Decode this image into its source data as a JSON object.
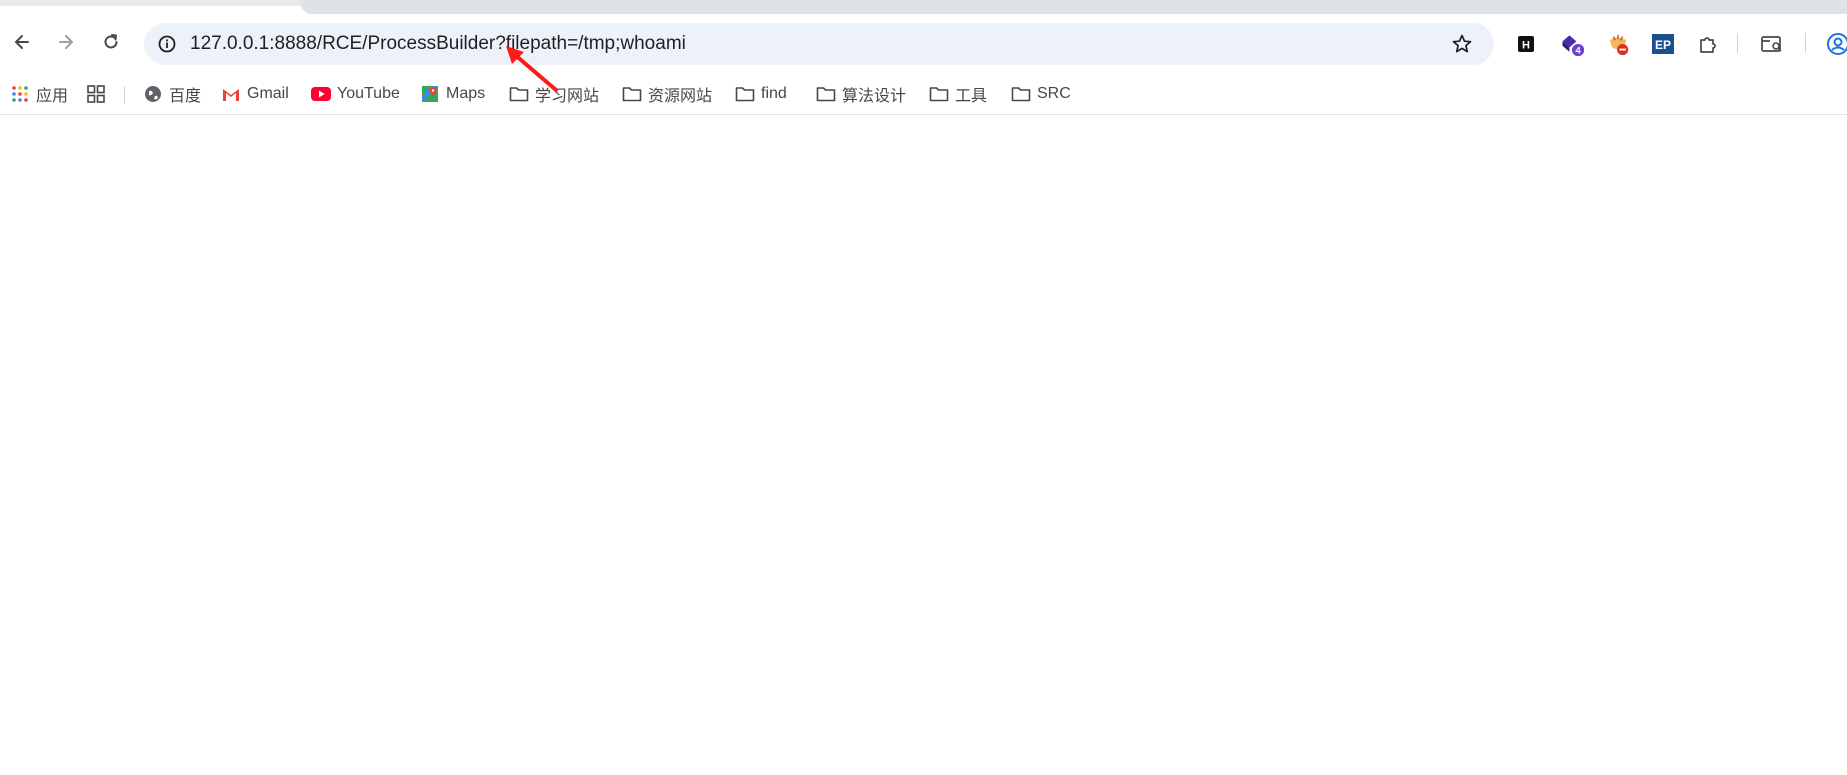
{
  "browser": {
    "address_bar": {
      "url": "127.0.0.1:8888/RCE/ProcessBuilder?filepath=/tmp;whoami",
      "site_info_icon": "info-circle-icon",
      "bookmark_icon": "star-icon"
    },
    "nav": {
      "back_icon": "arrow-left-icon",
      "forward_icon": "arrow-right-icon",
      "reload_icon": "reload-icon"
    },
    "extensions": [
      {
        "name": "hackbar-extension",
        "label": "H"
      },
      {
        "name": "extension-with-badge",
        "badge": "4"
      },
      {
        "name": "blocked-extension",
        "icon": "noodle-bowl-icon"
      },
      {
        "name": "ep-extension",
        "label": "EP"
      },
      {
        "name": "extensions-menu",
        "icon": "puzzle-icon"
      },
      {
        "name": "tab-search",
        "icon": "tab-search-icon"
      },
      {
        "name": "profile",
        "icon": "profile-icon"
      }
    ]
  },
  "bookmarks": [
    {
      "label": "应用",
      "icon": "apps-grid-icon"
    },
    {
      "label": "",
      "icon": "tab-groups-icon"
    },
    {
      "label": "百度",
      "icon": "globe-icon"
    },
    {
      "label": "Gmail",
      "icon": "gmail-icon"
    },
    {
      "label": "YouTube",
      "icon": "youtube-icon"
    },
    {
      "label": "Maps",
      "icon": "maps-icon"
    },
    {
      "label": "学习网站",
      "icon": "folder-icon"
    },
    {
      "label": "资源网站",
      "icon": "folder-icon"
    },
    {
      "label": "find",
      "icon": "folder-icon"
    },
    {
      "label": "算法设计",
      "icon": "folder-icon"
    },
    {
      "label": "工具",
      "icon": "folder-icon"
    },
    {
      "label": "SRC",
      "icon": "folder-icon"
    }
  ],
  "colors": {
    "omnibox_bg": "#edf2fa",
    "annotation_arrow": "#ff1a1a",
    "ext_badge": "#6a3fd1"
  }
}
